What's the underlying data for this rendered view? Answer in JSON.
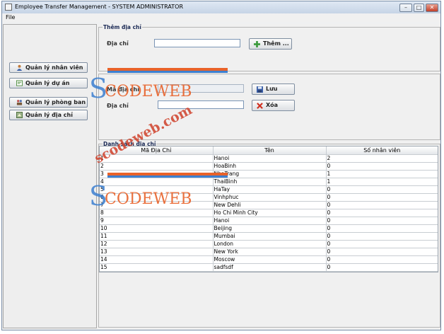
{
  "window": {
    "title": "Employee Transfer Management - SYSTEM ADMINISTRATOR",
    "min_glyph": "–",
    "max_glyph": "□",
    "close_glyph": "✕"
  },
  "menu": {
    "file": "File"
  },
  "sidebar": {
    "items": [
      {
        "label": "Quản lý nhân viên",
        "icon": "user-icon"
      },
      {
        "label": "Quản lý dự án",
        "icon": "project-icon"
      },
      {
        "label": "Quản lý phòng ban",
        "icon": "department-icon"
      },
      {
        "label": "Quản lý địa chỉ",
        "icon": "address-icon"
      }
    ]
  },
  "add_section": {
    "legend": "Thêm địa chỉ",
    "address_label": "Địa chỉ",
    "address_value": "",
    "add_button": "Thêm ..."
  },
  "edit_section": {
    "id_label": "Mã địa chỉ",
    "id_value": "",
    "address_label": "Địa chỉ",
    "address_value": "",
    "save_button": "Lưu",
    "delete_button": "Xóa"
  },
  "list_section": {
    "legend": "Danh sách địa chỉ",
    "columns": [
      "Mã Địa Chỉ",
      "Tên",
      "Số nhân viên"
    ],
    "rows": [
      [
        "1",
        "Hanoi",
        "2"
      ],
      [
        "2",
        "HoaBinh",
        "0"
      ],
      [
        "3",
        "NhaTrang",
        "1"
      ],
      [
        "4",
        "ThaiBinh",
        "1"
      ],
      [
        "5",
        "HaTay",
        "0"
      ],
      [
        "6",
        "Vinhphuc",
        "0"
      ],
      [
        "7",
        "New Dehli",
        "0"
      ],
      [
        "8",
        "Ho Chi Minh City",
        "0"
      ],
      [
        "9",
        "Hanoi",
        "0"
      ],
      [
        "10",
        "Beijing",
        "0"
      ],
      [
        "11",
        "Mumbai",
        "0"
      ],
      [
        "12",
        "London",
        "0"
      ],
      [
        "13",
        "New York",
        "0"
      ],
      [
        "14",
        "Moscow",
        "0"
      ],
      [
        "15",
        "sadfsdf",
        "0"
      ]
    ]
  },
  "watermark": {
    "brand": "CODEWEB",
    "brand_initial": "S",
    "url": "scodeweb.com",
    "color": "#e8622a",
    "blue": "#3c7fd0"
  }
}
